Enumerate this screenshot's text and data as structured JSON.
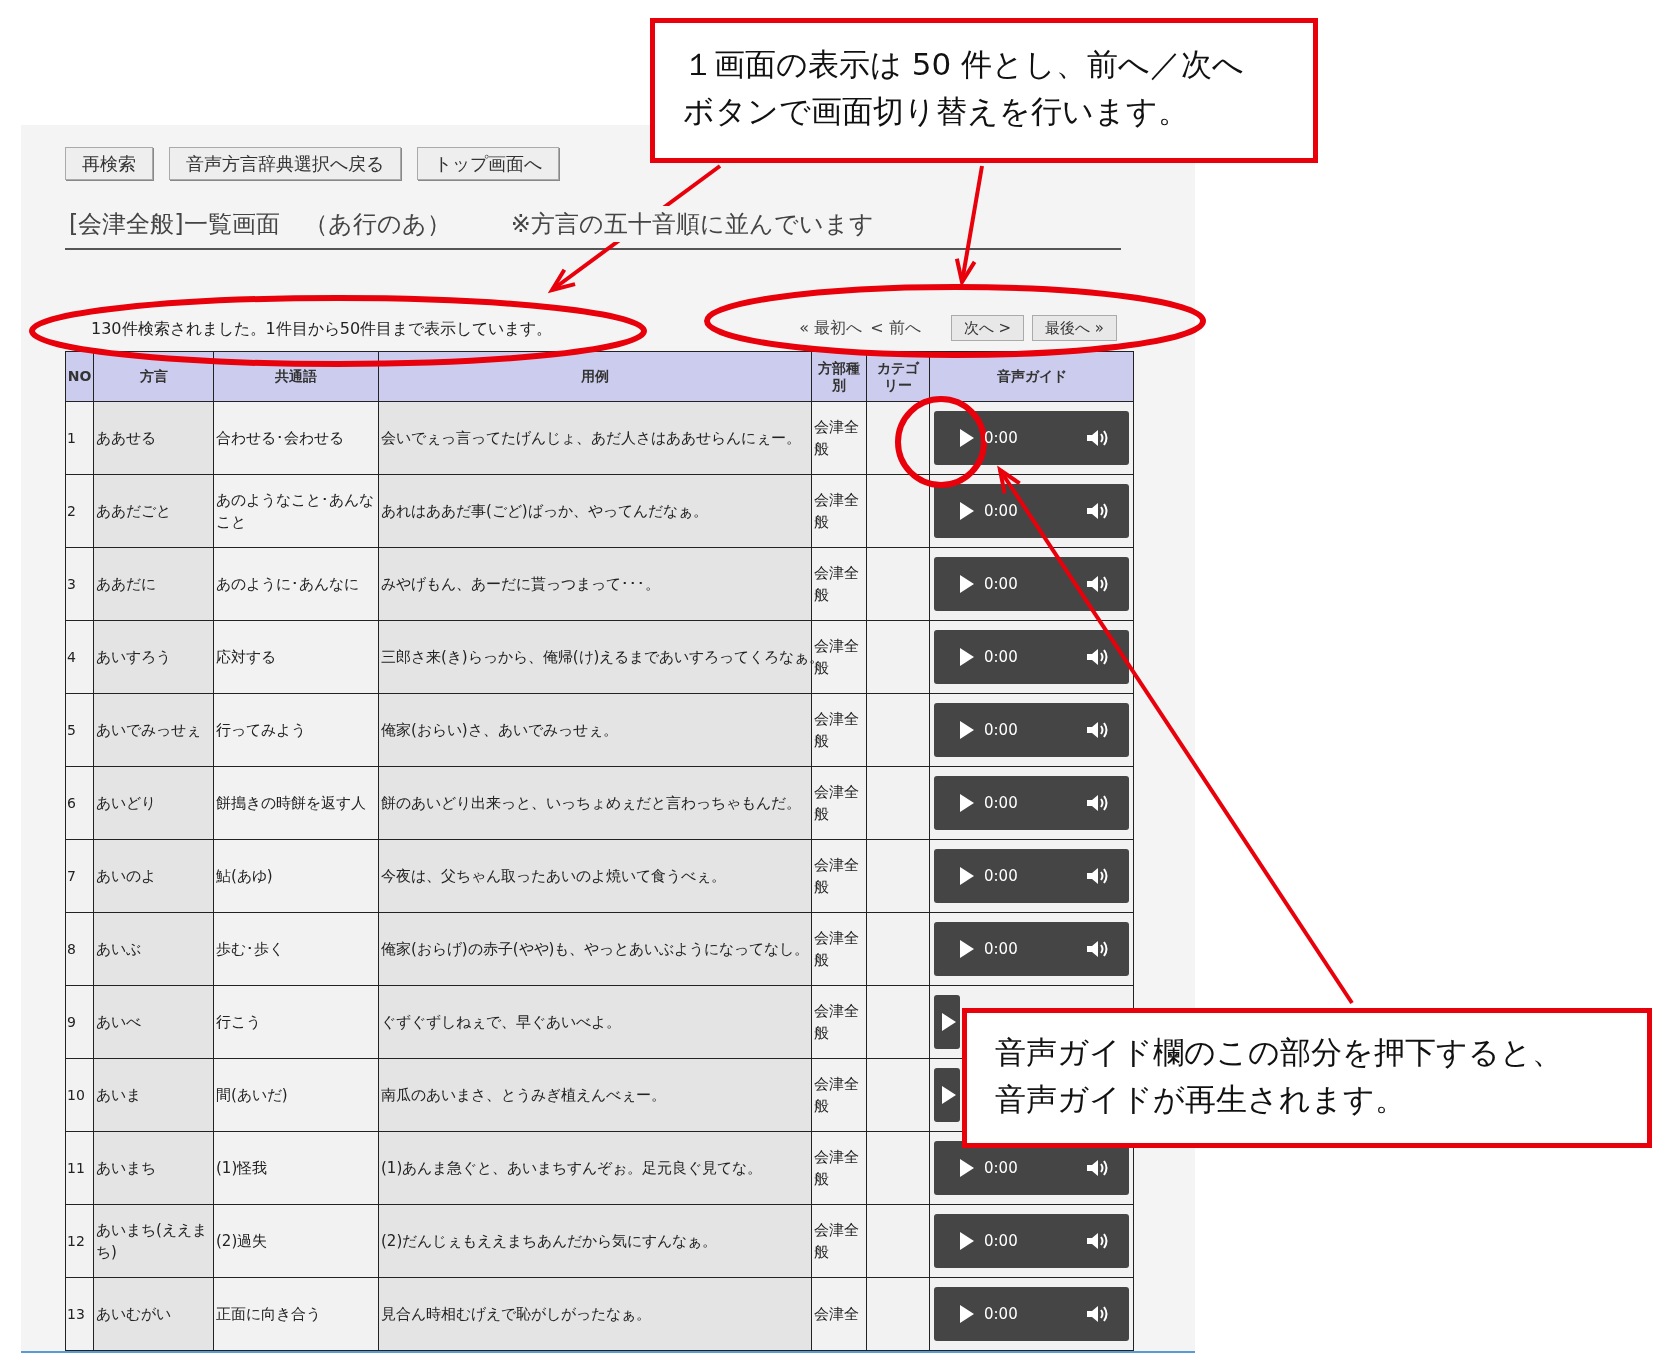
{
  "toolbar_buttons": [
    "再検索",
    "音声方言辞典選択へ戻る",
    "トップ画面へ"
  ],
  "page_title": "[会津全般]一覧画面　（あ行のあ）",
  "sort_note": "※方言の五十音順に並んでいます",
  "result_summary": "130件検索されました。1件目から50件目まで表示しています。",
  "pager": [
    {
      "label": "« 最初へ",
      "kind": "link"
    },
    {
      "label": "< 前へ",
      "kind": "link"
    },
    {
      "label": "次へ >",
      "kind": "button"
    },
    {
      "label": "最後へ »",
      "kind": "button"
    }
  ],
  "table": {
    "columns": [
      "NO",
      "方言",
      "共通語",
      "用例",
      "方部種別",
      "カテゴリー",
      "音声ガイド"
    ],
    "rows": [
      {
        "no": "1",
        "dialect": "ああせる",
        "standard": "合わせる･会わせる",
        "example": "会いでぇっ言ってたげんじょ、あだ人さはああせらんにぇー。",
        "region": "会津全般",
        "player_time": "0:00"
      },
      {
        "no": "2",
        "dialect": "ああだごと",
        "standard": "あのようなこと･あんなこと",
        "example": "あれはああだ事(ごど)ばっか、やってんだなぁ。",
        "region": "会津全般",
        "player_time": "0:00"
      },
      {
        "no": "3",
        "dialect": "ああだに",
        "standard": "あのように･あんなに",
        "example": "みやげもん、あーだに貰っつまって･･･。",
        "region": "会津全般",
        "player_time": "0:00"
      },
      {
        "no": "4",
        "dialect": "あいすろう",
        "standard": "応対する",
        "example": "三郎さ来(き)らっから、俺帰(け)えるまであいすろってくろなぁ。",
        "region": "会津全般",
        "player_time": "0:00"
      },
      {
        "no": "5",
        "dialect": "あいでみっせぇ",
        "standard": "行ってみよう",
        "example": "俺家(おらい)さ、あいでみっせぇ。",
        "region": "会津全般",
        "player_time": "0:00"
      },
      {
        "no": "6",
        "dialect": "あいどり",
        "standard": "餅搗きの時餅を返す人",
        "example": "餅のあいどり出来っと、いっちょめぇだと言わっちゃもんだ。",
        "region": "会津全般",
        "player_time": "0:00"
      },
      {
        "no": "7",
        "dialect": "あいのよ",
        "standard": "鮎(あゆ)",
        "example": "今夜は、父ちゃん取ったあいのよ焼いて食うべぇ。",
        "region": "会津全般",
        "player_time": "0:00"
      },
      {
        "no": "8",
        "dialect": "あいぶ",
        "standard": "歩む･歩く",
        "example": "俺家(おらげ)の赤子(やや)も、やっとあいぶようになってなし。",
        "region": "会津全般",
        "player_time": "0:00"
      },
      {
        "no": "9",
        "dialect": "あいべ",
        "standard": "行こう",
        "example": "ぐずぐずしねぇで、早ぐあいべよ。",
        "region": "会津全般"
      },
      {
        "no": "10",
        "dialect": "あいま",
        "standard": "間(あいだ)",
        "example": "南瓜のあいまさ、とうみぎ植えんべぇー。",
        "region": "会津全般"
      },
      {
        "no": "11",
        "dialect": "あいまち",
        "standard": "(1)怪我",
        "example": "(1)あんま急ぐと、あいまちすんぞぉ。足元良ぐ見てな。",
        "region": "会津全般",
        "player_time": "0:00"
      },
      {
        "no": "12",
        "dialect": "あいまち(ええまち)",
        "standard": "(2)過失",
        "example": "(2)だんじぇもええまちあんだから気にすんなぁ。",
        "region": "会津全般",
        "player_time": "0:00"
      },
      {
        "no": "13",
        "dialect": "あいむがい",
        "standard": "正面に向き合う",
        "example": "見合ん時相むげえで恥がしがったなぁ。",
        "region": "会津全",
        "player_time": "0:00"
      }
    ]
  },
  "annotations": [
    {
      "kind": "callout",
      "lines": [
        "１画面の表示は 50 件とし、前へ／次へ",
        "ボタンで画面切り替えを行います。"
      ]
    },
    {
      "kind": "callout",
      "lines": [
        "音声ガイド欄のこの部分を押下すると、",
        "音声ガイドが再生されます。"
      ]
    }
  ]
}
